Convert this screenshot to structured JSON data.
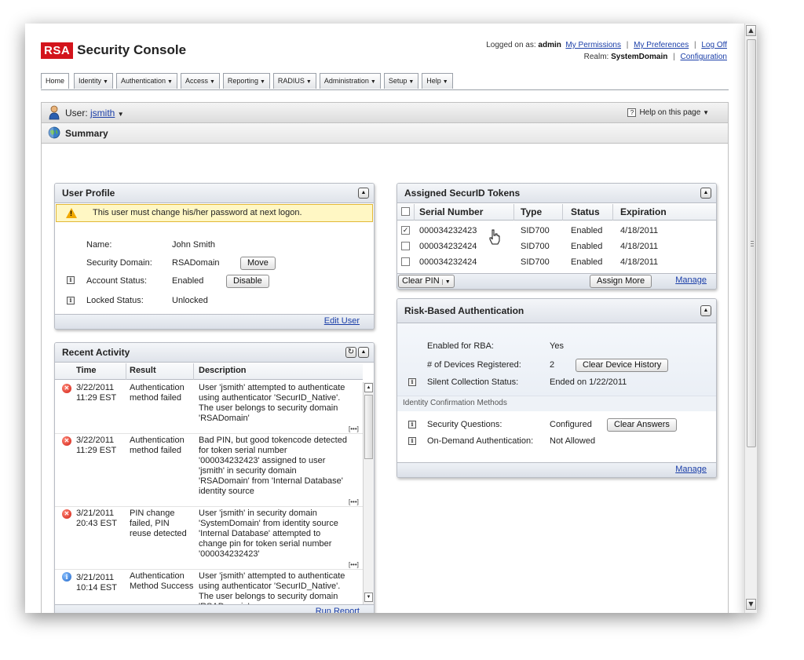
{
  "header": {
    "logo_mark": "RSA",
    "app_title": "Security Console",
    "logged_on_prefix": "Logged on as:",
    "logged_on_user": "admin",
    "links": [
      "My Permissions",
      "My Preferences",
      "Log Off"
    ],
    "realm_prefix": "Realm:",
    "realm": "SystemDomain",
    "configuration_link": "Configuration"
  },
  "nav": {
    "tabs": [
      {
        "label": "Home",
        "dropdown": false
      },
      {
        "label": "Identity",
        "dropdown": true
      },
      {
        "label": "Authentication",
        "dropdown": true
      },
      {
        "label": "Access",
        "dropdown": true
      },
      {
        "label": "Reporting",
        "dropdown": true
      },
      {
        "label": "RADIUS",
        "dropdown": true
      },
      {
        "label": "Administration",
        "dropdown": true
      },
      {
        "label": "Setup",
        "dropdown": true
      },
      {
        "label": "Help",
        "dropdown": true
      }
    ]
  },
  "userbar": {
    "prefix": "User:",
    "user_link": "jsmith",
    "help_label": "Help on this page"
  },
  "summary": {
    "label": "Summary"
  },
  "user_profile": {
    "title": "User Profile",
    "warning": "This user must change his/her password at next logon.",
    "name_label": "Name:",
    "name_value": "John Smith",
    "domain_label": "Security Domain:",
    "domain_value": "RSADomain",
    "move_button": "Move",
    "account_label": "Account Status:",
    "account_value": "Enabled",
    "disable_button": "Disable",
    "locked_label": "Locked Status:",
    "locked_value": "Unlocked",
    "edit_link": "Edit User"
  },
  "recent_activity": {
    "title": "Recent Activity",
    "columns": [
      "Time",
      "Result",
      "Description"
    ],
    "rows": [
      {
        "status": "error",
        "time": [
          "3/22/2011",
          "11:29 EST"
        ],
        "result": [
          "Authentication",
          "method failed"
        ],
        "description": [
          "User 'jsmith' attempted to authenticate",
          "using authenticator 'SecurID_Native'.",
          "The user belongs to security domain",
          "'RSADomain'"
        ]
      },
      {
        "status": "error",
        "time": [
          "3/22/2011",
          "11:29 EST"
        ],
        "result": [
          "Authentication",
          "method failed"
        ],
        "description": [
          "Bad PIN, but good tokencode detected",
          "for token serial number",
          "'000034232423' assigned to user",
          "'jsmith' in security domain",
          "'RSADomain' from 'Internal Database'",
          "identity source"
        ]
      },
      {
        "status": "error",
        "time": [
          "3/21/2011",
          "20:43 EST"
        ],
        "result": [
          "PIN change",
          "failed, PIN",
          "reuse detected"
        ],
        "description": [
          "User 'jsmith' in security domain",
          "'SystemDomain' from identity source",
          "'Internal Database' attempted to",
          "change pin for token serial number",
          "'000034232423'"
        ]
      },
      {
        "status": "success",
        "time": [
          "3/21/2011",
          "10:14 EST"
        ],
        "result": [
          "Authentication",
          "Method Success"
        ],
        "description": [
          "User 'jsmith' attempted to authenticate",
          "using authenticator 'SecurID_Native'.",
          "The user belongs to security domain",
          "'RSADomain'"
        ]
      }
    ],
    "more_label": "[•••]",
    "run_report_link": "Run Report"
  },
  "tokens": {
    "title": "Assigned SecurID Tokens",
    "columns": [
      "Serial Number",
      "Type",
      "Status",
      "Expiration"
    ],
    "rows": [
      {
        "checked": true,
        "serial": "000034232423",
        "type": "SID700",
        "status": "Enabled",
        "expiration": "4/18/2011"
      },
      {
        "checked": false,
        "serial": "000034232424",
        "type": "SID700",
        "status": "Enabled",
        "expiration": "4/18/2011"
      },
      {
        "checked": false,
        "serial": "000034232424",
        "type": "SID700",
        "status": "Enabled",
        "expiration": "4/18/2011"
      }
    ],
    "clear_pin": "Clear PIN",
    "assign_more": "Assign More",
    "manage_link": "Manage"
  },
  "rba": {
    "title": "Risk-Based Authentication",
    "enabled_label": "Enabled for RBA:",
    "enabled_value": "Yes",
    "devices_label": "# of Devices Registered:",
    "devices_value": "2",
    "clear_devices": "Clear Device History",
    "silent_label": "Silent Collection Status:",
    "silent_value": "Ended on 1/22/2011",
    "icm_header": "Identity Confirmation Methods",
    "sq_label": "Security Questions:",
    "sq_value": "Configured",
    "clear_answers": "Clear Answers",
    "oda_label": "On-Demand Authentication:",
    "oda_value": "Not Allowed",
    "manage_link": "Manage"
  },
  "colors": {
    "brand_red": "#d3141c",
    "link_blue": "#1a3ea8",
    "warning_bg": "#fff7c4",
    "panel_header": "#dfe3ea"
  },
  "icons": {
    "warning": "warning-icon",
    "error": "error-icon",
    "info": "info-icon",
    "success": "success-icon",
    "user": "user-icon",
    "summary": "summary-globe-icon",
    "help": "help-icon",
    "collapse": "collapse-icon",
    "refresh": "refresh-icon",
    "cursor": "hand-cursor-icon"
  }
}
